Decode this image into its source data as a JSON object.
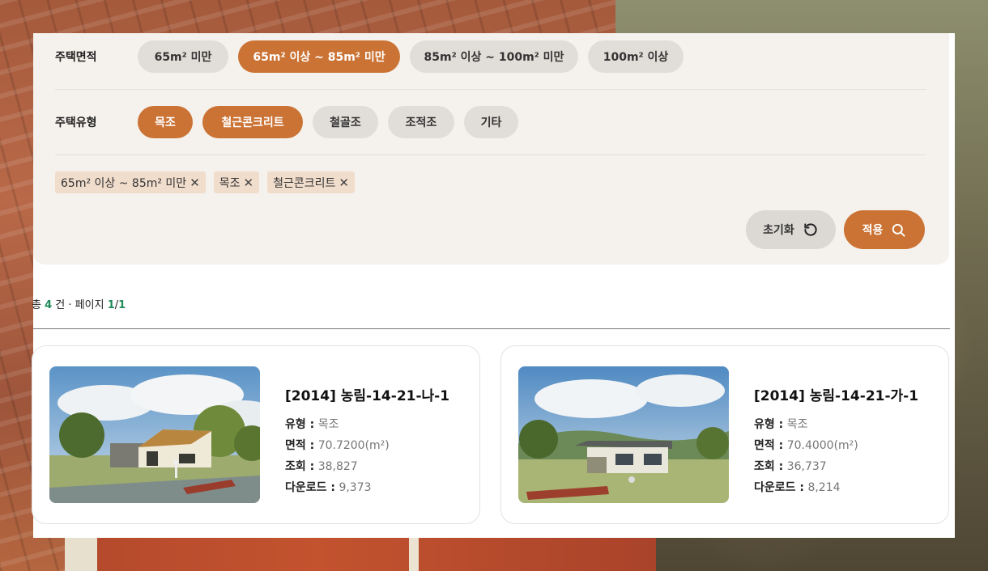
{
  "filters": {
    "area": {
      "label": "주택면적",
      "options": [
        "65m² 미만",
        "65m² 이상 ~ 85m² 미만",
        "85m² 이상 ~ 100m² 미만",
        "100m² 이상"
      ]
    },
    "type": {
      "label": "주택유형",
      "options": [
        "목조",
        "철근콘크리트",
        "철골조",
        "조적조",
        "기타"
      ]
    },
    "selected_tags": [
      "65m² 이상 ~ 85m² 미만",
      "목조",
      "철근콘크리트"
    ],
    "remove_symbol": "✕"
  },
  "actions": {
    "reset_label": "초기화",
    "apply_label": "적용"
  },
  "summary": {
    "prefix": "총",
    "count": "4",
    "unit": "건 · 페이지",
    "page": "1",
    "sep": "/",
    "total_pages": "1"
  },
  "results": [
    {
      "title": "[2014] 농림-14-21-나-1",
      "type_label": "유형 :",
      "type_value": "목조",
      "area_label": "면적 :",
      "area_value": "70.7200(m²)",
      "views_label": "조회 :",
      "views_value": "38,827",
      "downloads_label": "다운로드 :",
      "downloads_value": "9,373"
    },
    {
      "title": "[2014] 농림-14-21-가-1",
      "type_label": "유형 :",
      "type_value": "목조",
      "area_label": "면적 :",
      "area_value": "70.4000(m²)",
      "views_label": "조회 :",
      "views_value": "36,737",
      "downloads_label": "다운로드 :",
      "downloads_value": "8,214"
    }
  ],
  "colors": {
    "accent": "#cb7335",
    "chip_inactive": "#e1ddd8",
    "count_green": "#1f8a5a",
    "tag_bg": "#f1ddcc"
  },
  "icons": {
    "reset": "refresh-icon",
    "apply": "search-icon",
    "tag_remove": "close-icon"
  }
}
